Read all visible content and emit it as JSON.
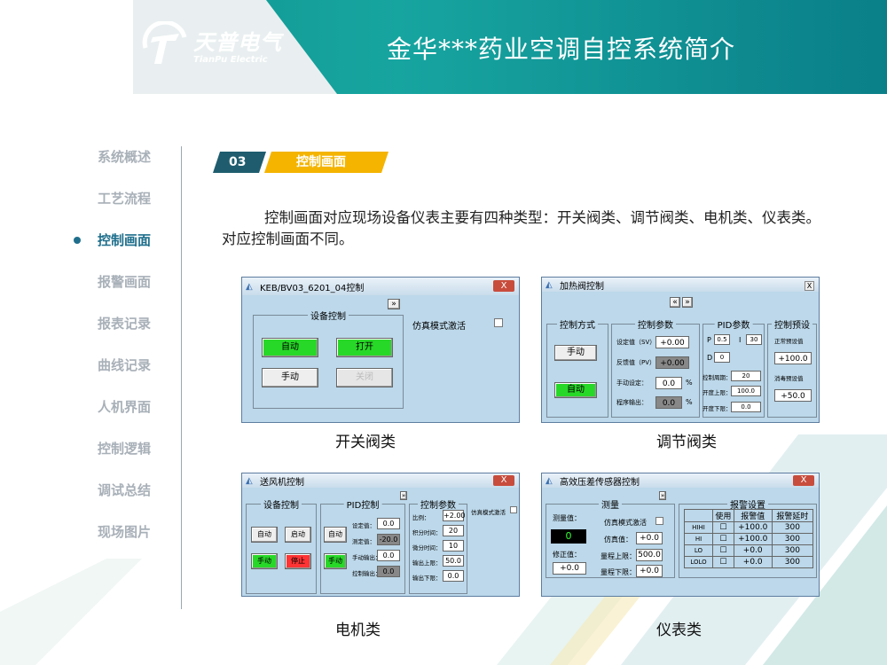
{
  "header": {
    "logo_cn": "天普电气",
    "logo_en": "TianPu Electric",
    "title": "金华***药业空调自控系统简介"
  },
  "nav": {
    "items": [
      {
        "label": "系统概述"
      },
      {
        "label": "工艺流程"
      },
      {
        "label": "控制画面"
      },
      {
        "label": "报警画面"
      },
      {
        "label": "报表记录"
      },
      {
        "label": "曲线记录"
      },
      {
        "label": "人机界面"
      },
      {
        "label": "控制逻辑"
      },
      {
        "label": "调试总结"
      },
      {
        "label": "现场图片"
      }
    ]
  },
  "section": {
    "number": "03",
    "label": "控制画面"
  },
  "paragraph": "控制画面对应现场设备仪表主要有四种类型：开关阀类、调节阀类、电机类、仪表类。对应控制画面不同。",
  "captions": {
    "switch_valve": "开关阀类",
    "reg_valve": "调节阀类",
    "motor": "电机类",
    "instrument": "仪表类"
  },
  "w1": {
    "title": "KEB/BV03_6201_04控制",
    "close": "X",
    "chevron": "»",
    "group": "设备控制",
    "auto": "自动",
    "open": "打开",
    "manual": "手动",
    "close_btn": "关闭",
    "sim": "仿真模式激活"
  },
  "w2": {
    "title": "加热阀控制",
    "close": "X",
    "prev": "«",
    "next": "»",
    "g1": "控制方式",
    "manual": "手动",
    "auto": "自动",
    "g2": "控制参数",
    "sv": "设定值（SV）",
    "pv": "反馈值（PV）",
    "man": "手动设定：",
    "prog": "程序输出：",
    "sv_val": "+0.00",
    "pv_val": "+0.00",
    "man_val": "0.0",
    "prog_val": "0.0",
    "pct": "%",
    "g3": "PID参数",
    "p": "P",
    "i": "I",
    "d": "D",
    "p_val": "0.5",
    "i_val": "30",
    "d_val": "0",
    "cycle": "控制周期：",
    "cycle_val": "20",
    "up": "开度上限：",
    "up_val": "100.0",
    "low": "开度下限：",
    "low_val": "0.0",
    "g4": "控制预设",
    "normal": "正常预设值",
    "normal_val": "+100.0",
    "dis": "消毒预设值",
    "dis_val": "+50.0"
  },
  "w3": {
    "title": "送风机控制",
    "close": "X",
    "chev": "»",
    "g1": "设备控制",
    "auto1": "自动",
    "start": "启动",
    "manual1": "手动",
    "stop": "停止",
    "g2": "PID控制",
    "auto2": "自动",
    "manual2": "手动",
    "sv": "设定值：",
    "sv_val": "0.0",
    "pv": "测定值：",
    "pv_val": "-20.0",
    "mo": "手动输出：",
    "mo_val": "0.0",
    "co": "控制输出：",
    "co_val": "0.0",
    "g3": "控制参数",
    "ratio": "比例：",
    "ratio_val": "+2.00",
    "int": "积分时间：",
    "int_val": "20",
    "der": "微分时间：",
    "der_val": "10",
    "ou": "输出上限：",
    "ou_val": "50.0",
    "ol": "输出下限：",
    "ol_val": "0.0",
    "sim": "仿真模式激活"
  },
  "w4": {
    "title": "高效压差传感器控制",
    "close": "X",
    "chev": "»",
    "g1": "测量",
    "meas": "测量值：",
    "meas_val": "0",
    "corr": "修正值：",
    "corr_val": "+0.0",
    "sim": "仿真模式激活",
    "sim_val_l": "仿真值：",
    "sim_val": "+0.0",
    "rng_up": "量程上限：",
    "rng_up_val": "500.0",
    "rng_lo": "量程下限：",
    "rng_lo_val": "+0.0",
    "g2": "报警设置",
    "hdr_use": "使用",
    "hdr_val": "报警值",
    "hdr_delay": "报警延时",
    "rows": [
      {
        "n": "HIHI",
        "v": "+100.0",
        "d": "300"
      },
      {
        "n": "HI",
        "v": "+100.0",
        "d": "300"
      },
      {
        "n": "LO",
        "v": "+0.0",
        "d": "300"
      },
      {
        "n": "LOLO",
        "v": "+0.0",
        "d": "300"
      }
    ]
  },
  "watermark": "天普电气",
  "colors": {
    "teal": "#17a5a0",
    "navy": "#1f5d6e",
    "yellow": "#f4b400",
    "btn_green": "#28d828",
    "btn_red": "#ff3333"
  }
}
